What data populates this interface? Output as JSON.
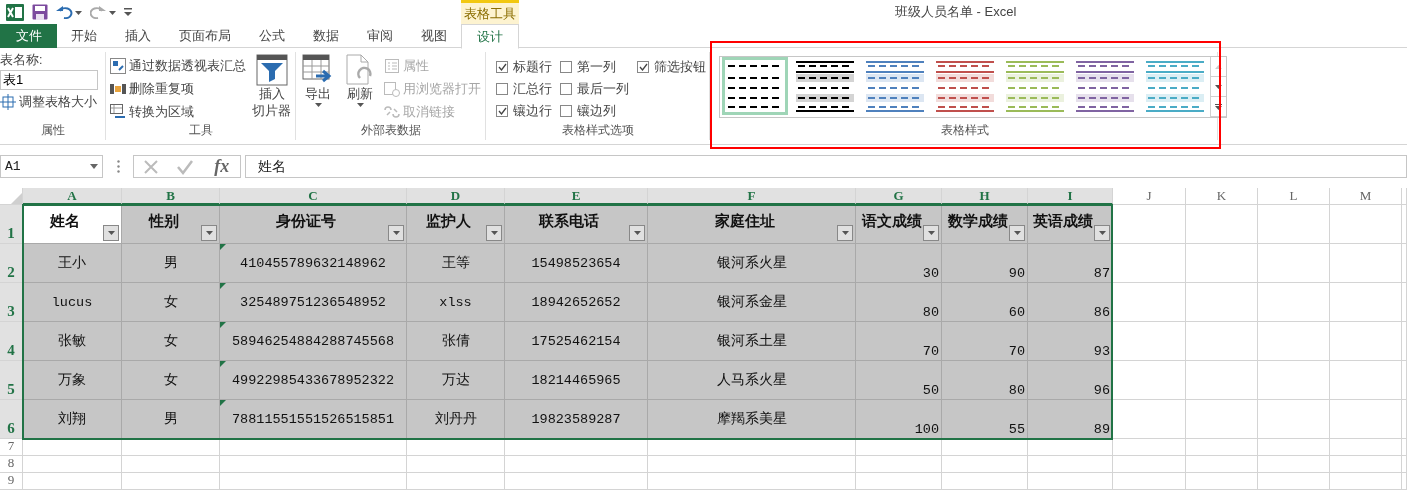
{
  "window": {
    "title": "班级人员名单 - Excel",
    "tool_group": "表格工具"
  },
  "ribbon_tabs": [
    {
      "label": "文件",
      "kind": "file",
      "selected": false
    },
    {
      "label": "开始",
      "kind": "tab",
      "selected": false
    },
    {
      "label": "插入",
      "kind": "tab",
      "selected": false
    },
    {
      "label": "页面布局",
      "kind": "tab",
      "selected": false
    },
    {
      "label": "公式",
      "kind": "tab",
      "selected": false
    },
    {
      "label": "数据",
      "kind": "tab",
      "selected": false
    },
    {
      "label": "审阅",
      "kind": "tab",
      "selected": false
    },
    {
      "label": "视图",
      "kind": "tab",
      "selected": false
    },
    {
      "label": "设计",
      "kind": "contextual",
      "selected": true
    }
  ],
  "ribbon_groups": [
    {
      "kind": "properties",
      "title": "属性",
      "name_label": "表名称:",
      "name_value": "表1",
      "items": [
        {
          "label": "调整表格大小",
          "disabled": false
        }
      ]
    },
    {
      "kind": "tools",
      "title": "工具",
      "items": [
        {
          "label": "通过数据透视表汇总",
          "disabled": false
        },
        {
          "label": "删除重复项",
          "disabled": false
        },
        {
          "label": "转换为区域",
          "disabled": false
        }
      ],
      "large_items": [
        {
          "label_lines": [
            "插入",
            "切片器"
          ],
          "disabled": false
        }
      ]
    },
    {
      "kind": "external",
      "title": "外部表数据",
      "large_items": [
        {
          "label_lines": [
            "导出"
          ],
          "disabled": false
        },
        {
          "label_lines": [
            "刷新"
          ],
          "disabled": false
        }
      ],
      "items": [
        {
          "label": "属性",
          "disabled": true
        },
        {
          "label": "用浏览器打开",
          "disabled": true
        },
        {
          "label": "取消链接",
          "disabled": true
        }
      ]
    },
    {
      "kind": "options",
      "title": "表格样式选项",
      "options": [
        {
          "label": "标题行",
          "checked": true
        },
        {
          "label": "汇总行",
          "checked": false
        },
        {
          "label": "镶边行",
          "checked": true
        },
        {
          "label": "第一列",
          "checked": false
        },
        {
          "label": "最后一列",
          "checked": false
        },
        {
          "label": "镶边列",
          "checked": false
        },
        {
          "label": "筛选按钮",
          "checked": true
        }
      ]
    },
    {
      "kind": "gallery",
      "title": "表格样式",
      "highlighted": true,
      "styles": [
        {
          "kind": "plain",
          "color": "#000000",
          "selected": true
        },
        {
          "kind": "grey-band",
          "color": "#000000",
          "selected": false
        },
        {
          "kind": "color-band",
          "color": "#4f81bd",
          "selected": false
        },
        {
          "kind": "color-band",
          "color": "#c0504d",
          "selected": false
        },
        {
          "kind": "color-band",
          "color": "#9bbb59",
          "selected": false
        },
        {
          "kind": "color-band",
          "color": "#8064a2",
          "selected": false
        },
        {
          "kind": "color-band",
          "color": "#4bacc6",
          "selected": false
        }
      ]
    }
  ],
  "formula_bar": {
    "name_box": "A1",
    "function_label": "fx",
    "formula": "姓名"
  },
  "sheet": {
    "columns": [
      {
        "letter": "A",
        "selected": true
      },
      {
        "letter": "B",
        "selected": true
      },
      {
        "letter": "C",
        "selected": true
      },
      {
        "letter": "D",
        "selected": true
      },
      {
        "letter": "E",
        "selected": true
      },
      {
        "letter": "F",
        "selected": true
      },
      {
        "letter": "G",
        "selected": true
      },
      {
        "letter": "H",
        "selected": true
      },
      {
        "letter": "I",
        "selected": true
      },
      {
        "letter": "J",
        "selected": false
      },
      {
        "letter": "K",
        "selected": false
      },
      {
        "letter": "L",
        "selected": false
      },
      {
        "letter": "M",
        "selected": false
      }
    ],
    "rows": [
      {
        "number": "1",
        "selected": true
      },
      {
        "number": "2",
        "selected": true
      },
      {
        "number": "3",
        "selected": true
      },
      {
        "number": "4",
        "selected": true
      },
      {
        "number": "5",
        "selected": true
      },
      {
        "number": "6",
        "selected": true
      },
      {
        "number": "7",
        "selected": false
      },
      {
        "number": "8",
        "selected": false
      },
      {
        "number": "9",
        "selected": false
      }
    ],
    "table": {
      "columns": [
        {
          "header": "姓名",
          "kind": "text",
          "active": true
        },
        {
          "header": "性别",
          "kind": "text",
          "active": false
        },
        {
          "header": "身份证号",
          "kind": "flagged",
          "active": false
        },
        {
          "header": "监护人",
          "kind": "text",
          "active": false
        },
        {
          "header": "联系电话",
          "kind": "text",
          "active": false
        },
        {
          "header": "家庭住址",
          "kind": "text",
          "active": false
        },
        {
          "header": "语文成绩",
          "kind": "number",
          "active": false
        },
        {
          "header": "数学成绩",
          "kind": "number",
          "active": false
        },
        {
          "header": "英语成绩",
          "kind": "number",
          "active": false
        }
      ],
      "rows": [
        [
          "王小",
          "男",
          "410455789632148962",
          "王等",
          "15498523654",
          "银河系火星",
          "30",
          "90",
          "87"
        ],
        [
          "lucus",
          "女",
          "325489751236548952",
          "xlss",
          "18942652652",
          "银河系金星",
          "80",
          "60",
          "86"
        ],
        [
          "张敏",
          "女",
          "58946254884288745568",
          "张倩",
          "17525462154",
          "银河系土星",
          "70",
          "70",
          "93"
        ],
        [
          "万象",
          "女",
          "49922985433678952322",
          "万达",
          "18214465965",
          "人马系火星",
          "50",
          "80",
          "96"
        ],
        [
          "刘翔",
          "男",
          "78811551551526515851",
          "刘丹丹",
          "19823589287",
          "摩羯系美星",
          "100",
          "55",
          "89"
        ]
      ]
    }
  }
}
